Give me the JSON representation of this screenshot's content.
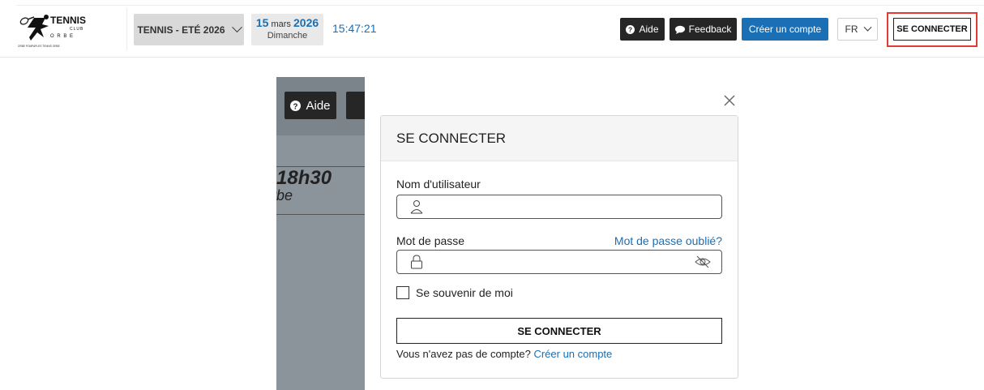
{
  "header": {
    "logo": {
      "text_main": "TENNIS",
      "text_club": "CLUB",
      "text_orbe": "O R B E",
      "tagline": "ORBE POMPAPLES          TENNIS ORBE"
    },
    "season_select": "TENNIS - ETÉ 2026",
    "date": {
      "day": "15",
      "month": "mars",
      "year": "2026",
      "weekday": "Dimanche"
    },
    "time": "15:47:21",
    "buttons": {
      "help": "Aide",
      "feedback": "Feedback",
      "create_account": "Créer un compte",
      "language": "FR",
      "login": "SE CONNECTER"
    }
  },
  "background": {
    "help": "Aide",
    "time": "18h30",
    "place": "rbe"
  },
  "modal": {
    "title": "SE CONNECTER",
    "username_label": "Nom d'utilisateur",
    "username_value": "",
    "password_label": "Mot de passe",
    "password_value": "",
    "forgot_password": "Mot de passe oublié?",
    "remember_me": "Se souvenir de moi",
    "submit": "SE CONNECTER",
    "no_account_text": "Vous n'avez pas de compte?",
    "create_account_link": "Créer un compte"
  },
  "colors": {
    "accent_blue": "#1a6fb5",
    "dark_button": "#262626",
    "highlight_red": "#e53935",
    "overlay_gray": "#8c949b"
  }
}
